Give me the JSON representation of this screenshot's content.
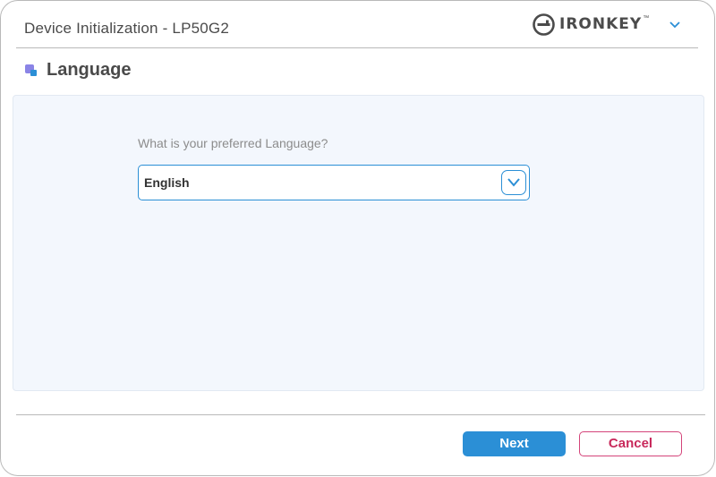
{
  "window": {
    "title": "Device Initialization - LP50G2"
  },
  "brand": {
    "name": "IRONKEY",
    "trademark": "™",
    "logo_icon": "ironkey-key-logo",
    "menu_icon": "chevron-down-icon"
  },
  "section": {
    "icon": "language-icon",
    "title": "Language"
  },
  "language_form": {
    "prompt": "What is your preferred Language?",
    "selected_value": "English",
    "dropdown_icon": "chevron-down-icon"
  },
  "buttons": {
    "next_label": "Next",
    "cancel_label": "Cancel"
  },
  "colors": {
    "accent": "#2b8fd6",
    "cancel": "#c8295b",
    "panel_background": "#f3f7fd",
    "icon_purple": "#8a84e6",
    "icon_blue": "#2b8fd6"
  }
}
